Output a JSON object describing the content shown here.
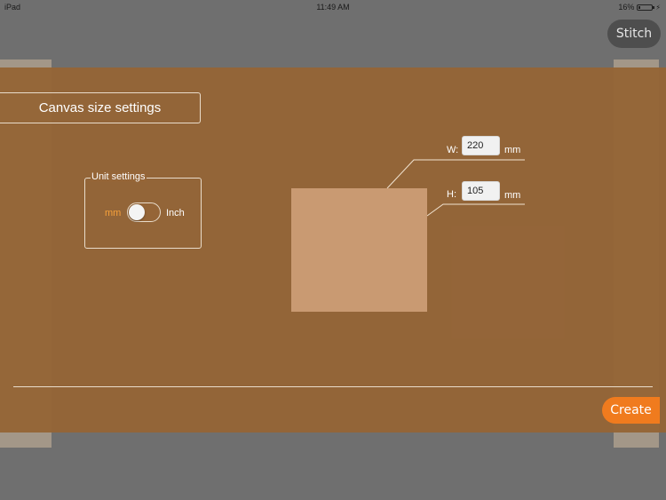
{
  "status_bar": {
    "device": "iPad",
    "time": "11:49 AM",
    "battery": "16%",
    "battery_level": 0.16
  },
  "toolbar": {
    "stitch_label": "Stitch"
  },
  "dialog": {
    "title": "Canvas size settings",
    "unit_settings": {
      "legend": "Unit settings",
      "mm_label": "mm",
      "inch_label": "Inch",
      "selected": "mm"
    },
    "size": {
      "width_label": "W:",
      "width_value": "220",
      "width_unit": "mm",
      "height_label": "H:",
      "height_value": "105",
      "height_unit": "mm"
    },
    "create_label": "Create"
  },
  "colors": {
    "overlay": "#956537",
    "accent": "#f07b1e",
    "mm_active": "#f7a13a",
    "preview": "#c99a72"
  }
}
